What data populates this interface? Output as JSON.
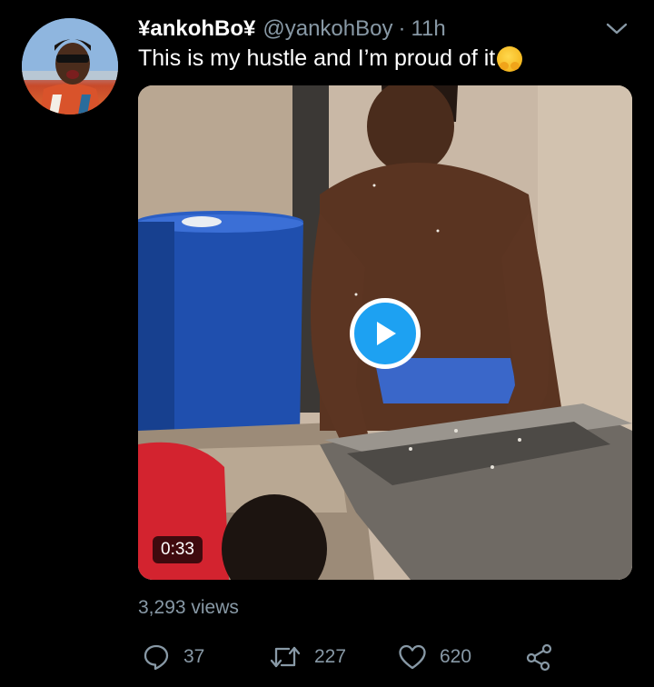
{
  "tweet": {
    "display_name": "¥ankohBo¥",
    "handle": "@yankohBoy",
    "separator": "·",
    "time": "11h",
    "text": "This is my hustle and I’m proud of it"
  },
  "video": {
    "duration": "0:33"
  },
  "stats": {
    "views": "3,293 views",
    "replies": "37",
    "retweets": "227",
    "likes": "620"
  },
  "colors": {
    "background": "#000000",
    "secondary_text": "#8899a6",
    "accent": "#1da1f2"
  },
  "icons": [
    "chevron-down-icon",
    "play-icon",
    "reply-icon",
    "retweet-icon",
    "like-icon",
    "share-icon",
    "hugging-face-emoji"
  ]
}
